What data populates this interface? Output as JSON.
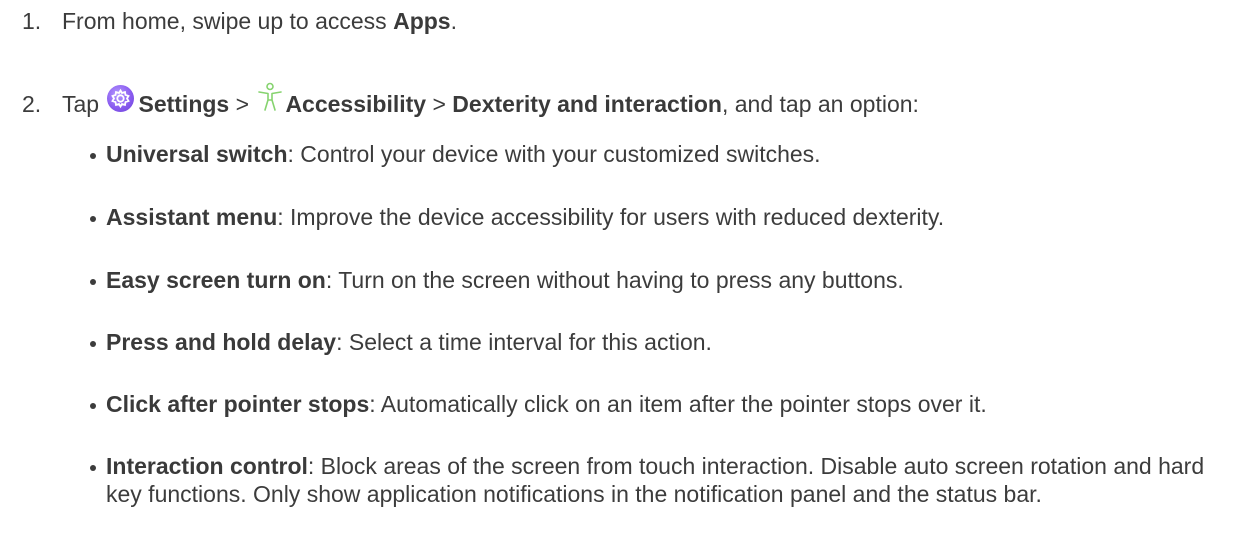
{
  "steps": [
    {
      "number": "1.",
      "text_before": "From home, swipe up to access ",
      "bold": "Apps",
      "text_after": "."
    },
    {
      "number": "2.",
      "tap": "Tap ",
      "settings_icon": "settings-gear-icon",
      "settings": "Settings",
      "sep1": " > ",
      "accessibility_icon": "accessibility-person-icon",
      "accessibility": "Accessibility",
      "sep2": " > ",
      "dexterity": "Dexterity and interaction",
      "text_after": ", and tap an option:"
    }
  ],
  "options": [
    {
      "name": "Universal switch",
      "description": ": Control your device with your customized switches."
    },
    {
      "name": "Assistant menu",
      "description": ": Improve the device accessibility for users with reduced dexterity."
    },
    {
      "name": "Easy screen turn on",
      "description": ": Turn on the screen without having to press any buttons."
    },
    {
      "name": "Press and hold delay",
      "description": ": Select a time interval for this action."
    },
    {
      "name": "Click after pointer stops",
      "description": ": Automatically click on an item after the pointer stops over it."
    },
    {
      "name": "Interaction control",
      "description": ": Block areas of the screen from touch interaction. Disable auto screen rotation and hard key functions. Only show application notifications in the notification panel and the status bar."
    }
  ],
  "colors": {
    "text": "#3c3c3c",
    "settings_icon": "#8a5cf0",
    "accessibility_icon": "#7fcf6a"
  }
}
